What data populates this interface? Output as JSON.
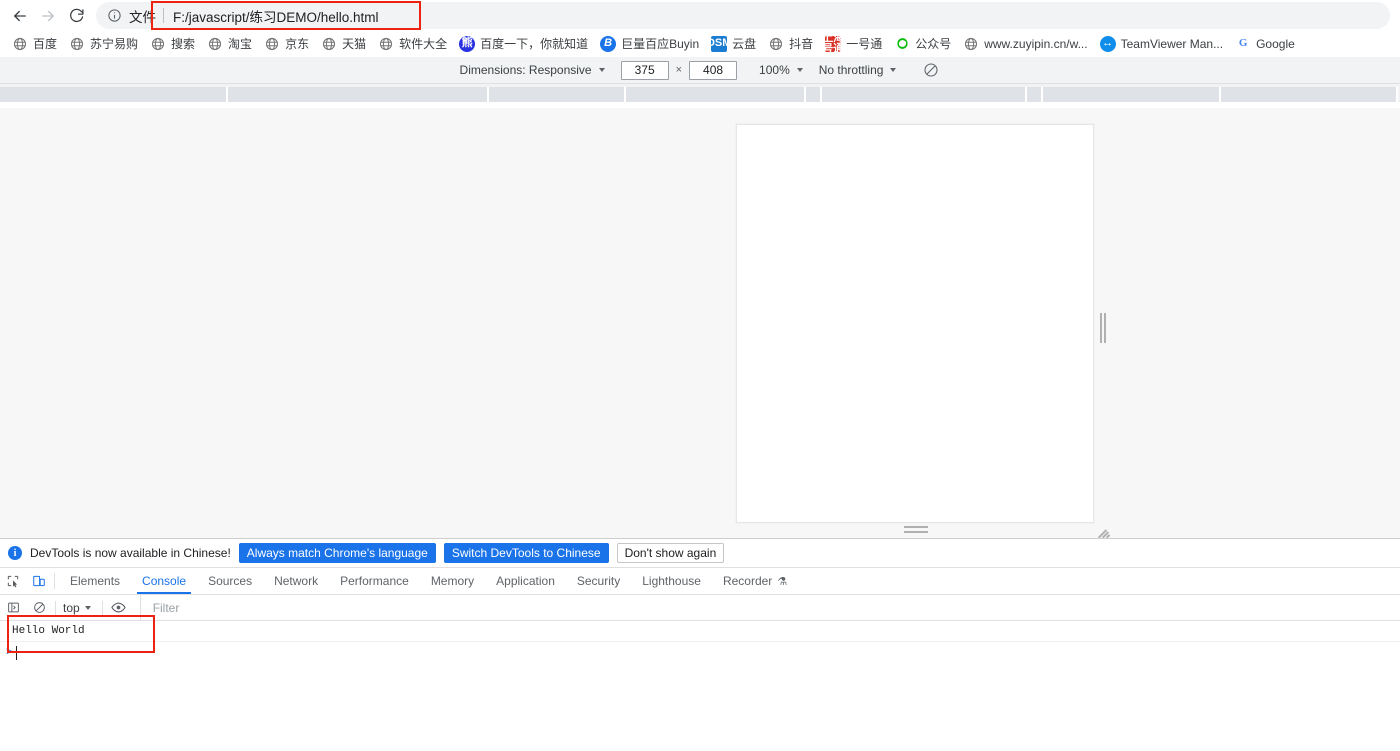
{
  "browser": {
    "nav": {
      "back": "back-arrow",
      "forward": "forward-arrow",
      "reload": "reload-arrow"
    },
    "omnibox": {
      "info_icon": "info-circle-icon",
      "scheme_label": "文件",
      "url": "F:/javascript/练习DEMO/hello.html"
    },
    "bookmarks": [
      {
        "label": "百度",
        "icon": "globe-icon"
      },
      {
        "label": "苏宁易购",
        "icon": "globe-icon"
      },
      {
        "label": "搜索",
        "icon": "globe-icon"
      },
      {
        "label": "淘宝",
        "icon": "globe-icon"
      },
      {
        "label": "京东",
        "icon": "globe-icon"
      },
      {
        "label": "天猫",
        "icon": "globe-icon"
      },
      {
        "label": "软件大全",
        "icon": "globe-icon"
      },
      {
        "label": "百度一下，你就知道",
        "icon": "baidu-paw-icon"
      },
      {
        "label": "巨量百应Buyin",
        "icon": "buyin-b-icon"
      },
      {
        "label": "云盘",
        "icon": "dsm-icon"
      },
      {
        "label": "抖音",
        "icon": "globe-icon"
      },
      {
        "label": "一号通",
        "icon": "yihaotong-icon"
      },
      {
        "label": "公众号",
        "icon": "wechat-icon"
      },
      {
        "label": "www.zuyipin.cn/w...",
        "icon": "globe-icon"
      },
      {
        "label": "TeamViewer Man...",
        "icon": "teamviewer-icon"
      },
      {
        "label": "Google",
        "icon": "google-g-icon"
      }
    ]
  },
  "device_toolbar": {
    "dimensions_label": "Dimensions: Responsive",
    "width": "375",
    "multiply": "×",
    "height": "408",
    "zoom": "100%",
    "throttling": "No throttling",
    "throttle_icon": "no-throttle-icon"
  },
  "devtools": {
    "notice": {
      "icon": "info-icon",
      "message": "DevTools is now available in Chinese!",
      "buttons": [
        {
          "label": "Always match Chrome's language",
          "style": "primary"
        },
        {
          "label": "Switch DevTools to Chinese",
          "style": "primary"
        },
        {
          "label": "Don't show again",
          "style": "plain"
        }
      ]
    },
    "tabs": [
      {
        "label": "Elements",
        "active": false
      },
      {
        "label": "Console",
        "active": true
      },
      {
        "label": "Sources",
        "active": false
      },
      {
        "label": "Network",
        "active": false
      },
      {
        "label": "Performance",
        "active": false
      },
      {
        "label": "Memory",
        "active": false
      },
      {
        "label": "Application",
        "active": false
      },
      {
        "label": "Security",
        "active": false
      },
      {
        "label": "Lighthouse",
        "active": false
      },
      {
        "label": "Recorder",
        "active": false,
        "experimental": true
      }
    ],
    "console_toolbar": {
      "sidebar_icon": "console-sidebar-icon",
      "clear_icon": "clear-console-icon",
      "context": "top",
      "eye_icon": "live-expression-eye-icon",
      "filter_placeholder": "Filter"
    },
    "console_output": [
      {
        "text": "Hello World"
      }
    ],
    "console_prompt": ">"
  },
  "annotations": {
    "url_box_color": "#ee2211",
    "console_box_color": "#ee2211"
  }
}
